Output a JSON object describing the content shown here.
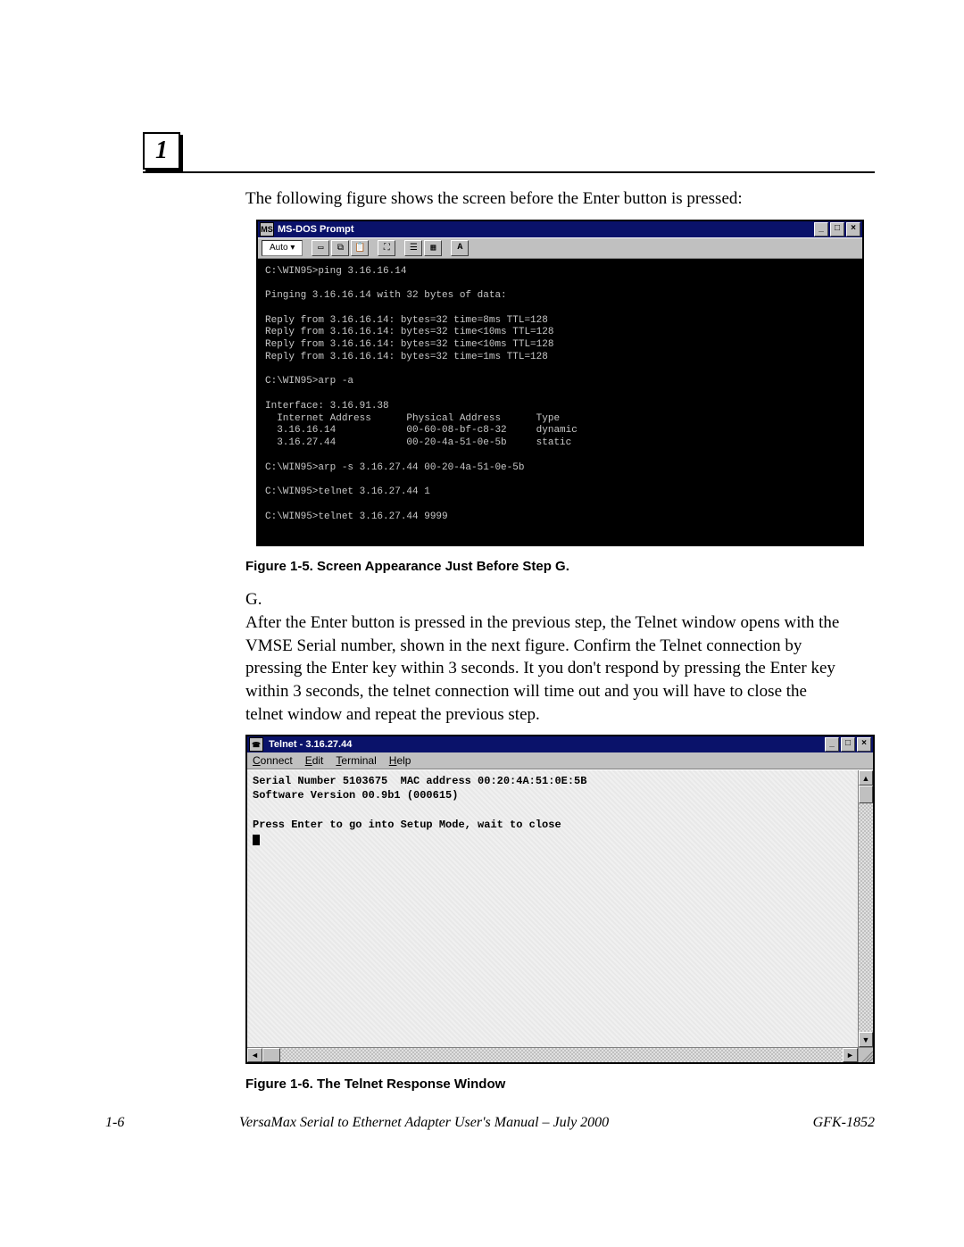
{
  "chapter_number": "1",
  "intro_text": "The following figure shows the screen before the Enter button is pressed:",
  "dos_window": {
    "title": "MS-DOS Prompt",
    "toolbar_auto": "Auto",
    "body": "C:\\WIN95>ping 3.16.16.14\n\nPinging 3.16.16.14 with 32 bytes of data:\n\nReply from 3.16.16.14: bytes=32 time=8ms TTL=128\nReply from 3.16.16.14: bytes=32 time<10ms TTL=128\nReply from 3.16.16.14: bytes=32 time<10ms TTL=128\nReply from 3.16.16.14: bytes=32 time=1ms TTL=128\n\nC:\\WIN95>arp -a\n\nInterface: 3.16.91.38\n  Internet Address      Physical Address      Type\n  3.16.16.14            00-60-08-bf-c8-32     dynamic\n  3.16.27.44            00-20-4a-51-0e-5b     static\n\nC:\\WIN95>arp -s 3.16.27.44 00-20-4a-51-0e-5b\n\nC:\\WIN95>telnet 3.16.27.44 1\n\nC:\\WIN95>telnet 3.16.27.44 9999"
  },
  "figure1_caption": "Figure 1-5.  Screen Appearance Just Before Step G.",
  "step_g": {
    "label": "G.",
    "text": "After the Enter button is pressed in the previous step, the Telnet window opens with the VMSE Serial number, shown in the next figure.  Confirm the Telnet connection by pressing the Enter key within 3 seconds. It you don't respond by pressing the Enter key within 3 seconds, the telnet connection will time out and you will have to close the telnet window and repeat the previous step."
  },
  "telnet_window": {
    "title": "Telnet - 3.16.27.44",
    "menu": {
      "connect": "Connect",
      "edit": "Edit",
      "terminal": "Terminal",
      "help": "Help"
    },
    "body_line1": "Serial Number 5103675  MAC address 00:20:4A:51:0E:5B",
    "body_line2": "Software Version 00.9b1 (000615)",
    "body_line3": "Press Enter to go into Setup Mode, wait to close"
  },
  "figure2_caption": "Figure 1-6.  The Telnet Response Window",
  "footer": {
    "page": "1-6",
    "manual": "VersaMax Serial to Ethernet Adapter User's Manual – July 2000",
    "docnum": "GFK-1852"
  },
  "win_controls": {
    "min": "_",
    "max": "□",
    "close": "×",
    "dropdown": "▾",
    "up": "▲",
    "down": "▼",
    "left": "◄",
    "right": "►",
    "letter_a": "A"
  }
}
